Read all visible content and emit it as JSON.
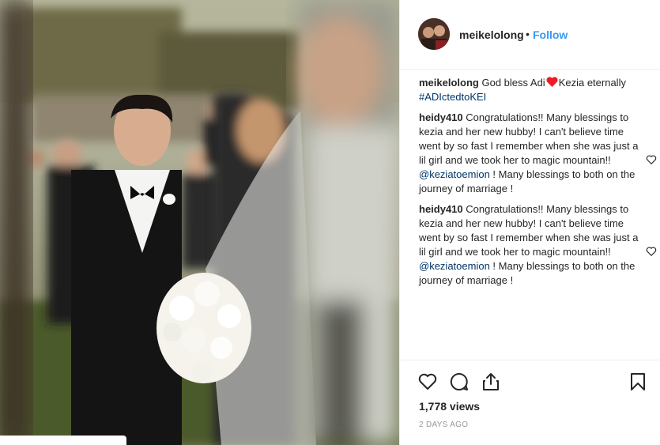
{
  "post": {
    "author": "meikelolong",
    "follow_label": "Follow",
    "separator": "•",
    "caption_user": "meikelolong",
    "caption_text_1": " God bless Adi",
    "caption_heart": "heart-emoji",
    "caption_text_2": "Kezia eternally",
    "caption_hashtag": "#ADIctedtoKEI",
    "comments": [
      {
        "user": "heidy410",
        "text_1": " Congratulations!! Many blessings to kezia and her new hubby! I can't believe time went by so fast I remember when she was just a lil girl and we took her to magic mountain!! ",
        "mention": "@keziatoemion",
        "text_2": " ! Many blessings to both on the journey of marriage !"
      },
      {
        "user": "heidy410",
        "text_1": " Congratulations!! Many blessings to kezia and her new hubby! I can't believe time went by so fast I remember when she was just a lil girl and we took her to magic mountain!! ",
        "mention": "@keziatoemion",
        "text_2": " ! Many blessings to both on the journey of marriage !"
      }
    ],
    "views": "1,778 views",
    "date": "2 DAYS AGO"
  },
  "icons": {
    "like": "heart-icon",
    "comment": "comment-icon",
    "share": "share-icon",
    "save": "bookmark-icon"
  },
  "colors": {
    "link": "#3897f0",
    "mention": "#003569",
    "heart_emoji": "#ed1c24"
  }
}
